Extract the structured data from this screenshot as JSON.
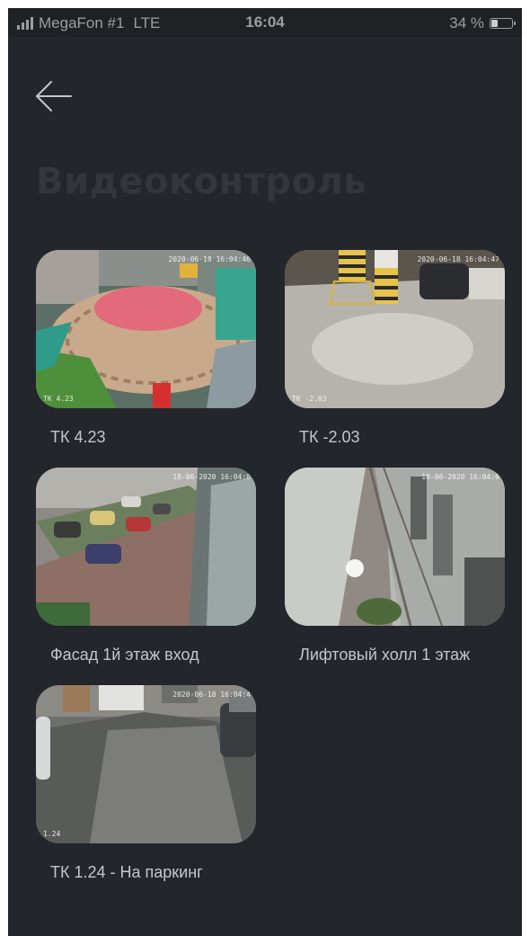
{
  "status_bar": {
    "carrier": "MegaFon #1",
    "network": "LTE",
    "time": "16:04",
    "battery_percent": "34 %",
    "battery_level": 0.34
  },
  "header": {
    "back_icon": "arrow-left-icon",
    "title": "Видеоконтроль"
  },
  "cameras": [
    {
      "name": "ТК 4.23",
      "timestamp": "2020-06-18 16:04:46",
      "corner": "ТК 4.23"
    },
    {
      "name": "ТК -2.03",
      "timestamp": "2020-06-18 16:04:47",
      "corner": "ТК -2.03"
    },
    {
      "name": "Фасад 1й этаж вход",
      "timestamp": "18-06-2020 16:04:0",
      "corner": ""
    },
    {
      "name": "Лифтовый холл 1 этаж",
      "timestamp": "18-06-2020 16:04:0",
      "corner": ""
    },
    {
      "name": "ТК 1.24 - На паркинг",
      "timestamp": "2020-06-18 16:04:4",
      "corner": "1.24"
    }
  ],
  "colors": {
    "background": "#23262b",
    "label": "#c3c6cc",
    "title": "#33363c"
  }
}
